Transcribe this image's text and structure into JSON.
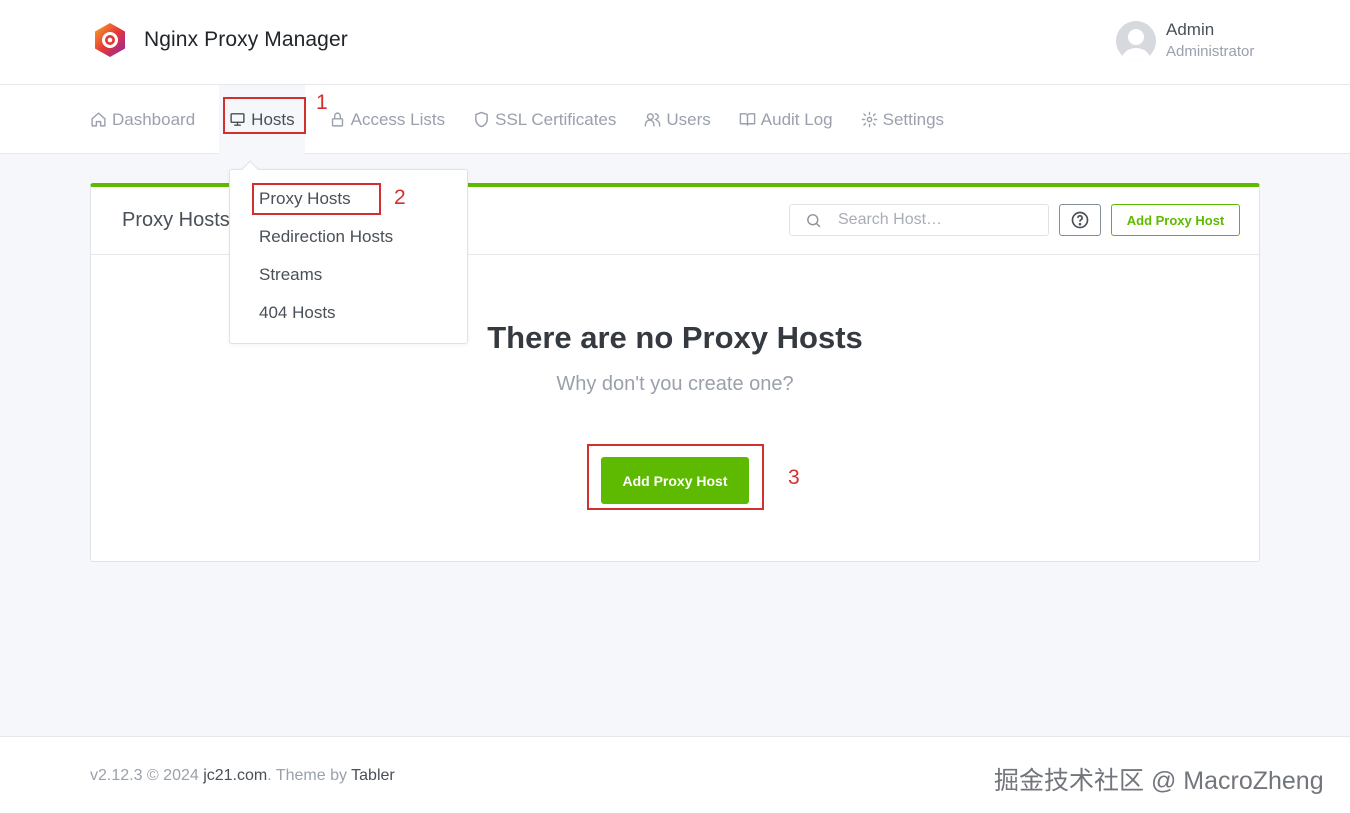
{
  "app": {
    "title": "Nginx Proxy Manager"
  },
  "user": {
    "name": "Admin",
    "role": "Administrator"
  },
  "nav": [
    {
      "label": "Dashboard",
      "icon": "home-icon"
    },
    {
      "label": "Hosts",
      "icon": "monitor-icon"
    },
    {
      "label": "Access Lists",
      "icon": "lock-icon"
    },
    {
      "label": "SSL Certificates",
      "icon": "shield-icon"
    },
    {
      "label": "Users",
      "icon": "users-icon"
    },
    {
      "label": "Audit Log",
      "icon": "book-icon"
    },
    {
      "label": "Settings",
      "icon": "gear-icon"
    }
  ],
  "dropdown": {
    "items": [
      "Proxy Hosts",
      "Redirection Hosts",
      "Streams",
      "404 Hosts"
    ]
  },
  "card": {
    "title": "Proxy Hosts",
    "search_placeholder": "Search Host…",
    "add_button": "Add Proxy Host",
    "empty_title": "There are no Proxy Hosts",
    "empty_subtitle": "Why don't you create one?",
    "empty_button": "Add Proxy Host"
  },
  "annotations": [
    "1",
    "2",
    "3"
  ],
  "footer": {
    "version": "v2.12.3 © 2024 ",
    "link1": "jc21.com",
    "theme_by": ". Theme by ",
    "link2": "Tabler",
    "watermark": "掘金技术社区 @ MacroZheng"
  },
  "colors": {
    "accent": "#5eba00",
    "annotation": "#d32f2f"
  }
}
